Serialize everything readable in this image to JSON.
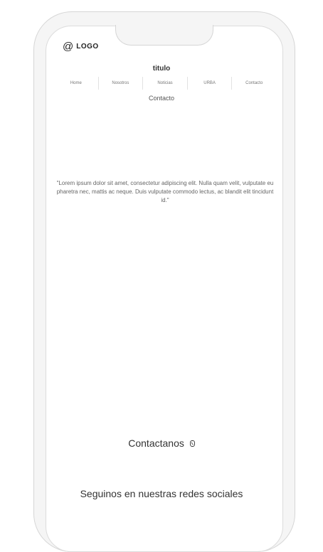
{
  "logo": {
    "icon": "at-icon",
    "text": "LOGO"
  },
  "header": {
    "title": "titulo"
  },
  "nav": {
    "items": [
      {
        "label": "Home"
      },
      {
        "label": "Nosotros"
      },
      {
        "label": "Noticias"
      },
      {
        "label": "URBA"
      },
      {
        "label": "Contacto"
      }
    ]
  },
  "page": {
    "subtitle": "Contacto"
  },
  "content": {
    "quote": "\"Lorem ipsum dolor sit amet, consectetur adipiscing elit. Nulla quam velit, vulputate eu pharetra nec, mattis ac neque. Duis vulputate commodo lectus, ac blandit elit tincidunt id.\""
  },
  "contact": {
    "label": "Contactanos",
    "icon": "phone-icon"
  },
  "social": {
    "label": "Seguinos en nuestras redes sociales"
  }
}
